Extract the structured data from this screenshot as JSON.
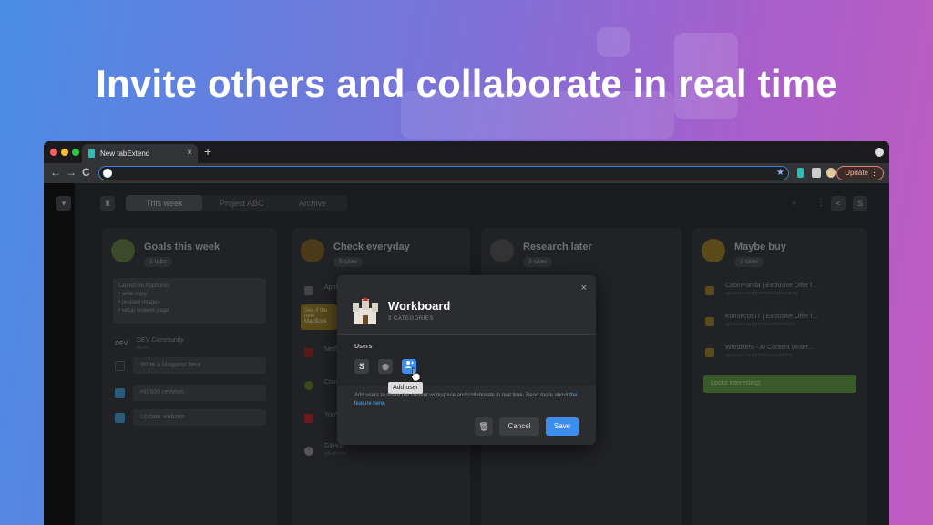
{
  "hero": {
    "headline": "Invite others and collaborate in real time"
  },
  "browser": {
    "tab_title": "New tabExtend",
    "tab_close": "×",
    "new_tab": "+",
    "nav_back": "←",
    "nav_forward": "→",
    "nav_reload": "C",
    "star": "★",
    "update_label": "Update",
    "kebab": "⋮"
  },
  "app": {
    "tabs": [
      "This week",
      "Project ABC",
      "Archive"
    ],
    "columns": [
      {
        "title": "Goals this week",
        "count": "1 tabs",
        "note_lines": [
          "Launch on AppSumo",
          "• write copy",
          "• prepare images",
          "• setup redeem page"
        ],
        "items": [
          {
            "label": "DEV Community",
            "sub": "dev.to"
          },
          {
            "label": "Write a blogpost here"
          },
          {
            "label": "Hit 500 reviews"
          },
          {
            "label": "Update website"
          }
        ]
      },
      {
        "title": "Check everyday",
        "count": "5 sites",
        "items": [
          "Apple",
          "Netflix",
          "Coingecko",
          "YouTube"
        ],
        "github": {
          "label": "GitHub",
          "sub": "github.com"
        },
        "tooltip_fragment": "See if the new MacBook"
      },
      {
        "title": "Research later",
        "count": "2 sites"
      },
      {
        "title": "Maybe buy",
        "count": "3 sites",
        "items": [
          {
            "label": "CabinPanda | Exclusive Offer f...",
            "sub": "appsumo.com/products/cabinpanda"
          },
          {
            "label": "Konnectzi IT | Exclusive Offer f...",
            "sub": "appsumo.com/products/konnectzit"
          },
          {
            "label": "WordHero - AI Content Writer...",
            "sub": "appsumo.com/products/wordhero"
          }
        ],
        "note": "Looks interesting!"
      }
    ]
  },
  "modal": {
    "title": "Workboard",
    "subtitle": "3 CATEGORIES",
    "users_label": "Users",
    "user_initial": "S",
    "tooltip": "Add user",
    "help_text": "Add users to share the current workspace and collaborate in real time. Read more about",
    "help_link": "the feature here.",
    "close": "×",
    "cancel_label": "Cancel",
    "save_label": "Save"
  },
  "colors": {
    "accent": "#3b8ef0",
    "update_border": "#e8816f",
    "favicon": "#29c0b3"
  }
}
